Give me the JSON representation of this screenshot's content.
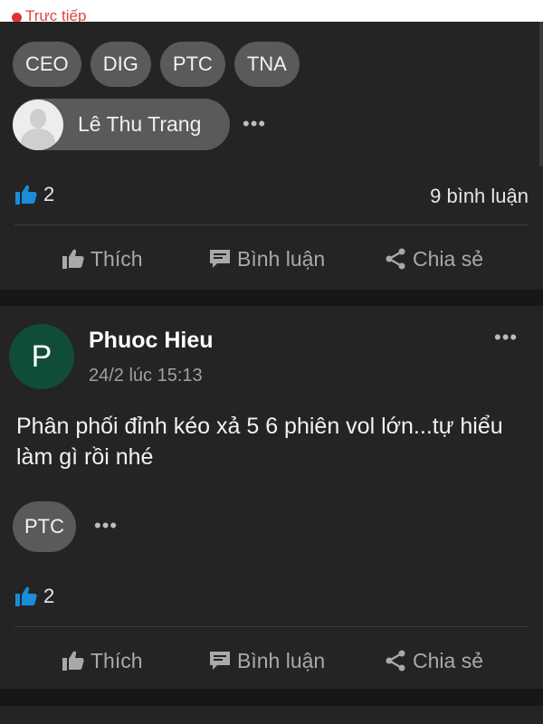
{
  "top_strip": {
    "live_label": "Trực tiếp"
  },
  "post1": {
    "tags": [
      "CEO",
      "DIG",
      "PTC",
      "TNA"
    ],
    "mention": {
      "name": "Lê Thu Trang"
    },
    "more_label": "•••",
    "likes": "2",
    "comments": "9 bình luận"
  },
  "post2": {
    "avatar_letter": "P",
    "author": "Phuoc Hieu",
    "timestamp": "24/2 lúc 15:13",
    "text": "Phân phối đỉnh kéo xả 5 6 phiên vol lớn...tự hiểu làm gì rồi nhé",
    "tags": [
      "PTC"
    ],
    "more_label": "•••",
    "likes": "2"
  },
  "actions": {
    "like": "Thích",
    "comment": "Bình luận",
    "share": "Chia sẻ"
  },
  "colors": {
    "like_blue": "#1a8cd8",
    "avatar_green": "#0f4d3a"
  }
}
